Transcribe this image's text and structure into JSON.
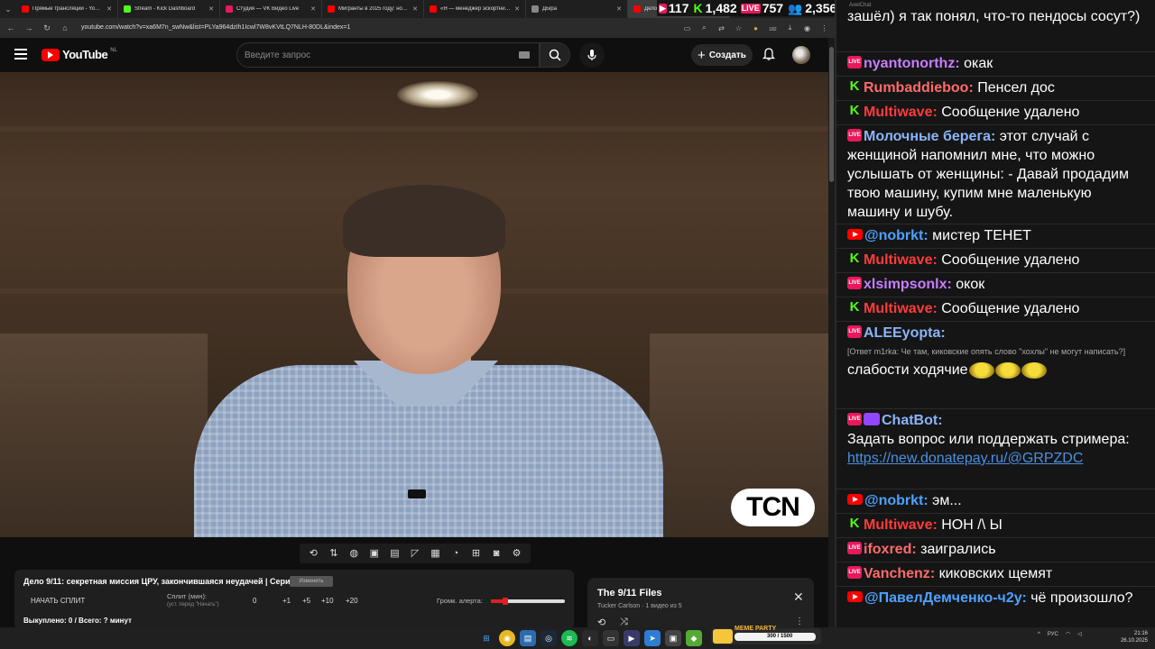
{
  "browser": {
    "tabs": [
      {
        "label": "Прямые трансляции - YouTube",
        "color": "#ff0000"
      },
      {
        "label": "Stream - Kick Dashboard",
        "color": "#53fc18"
      },
      {
        "label": "Студия — VK Видео Live",
        "color": "#e8195b"
      },
      {
        "label": "Мигранты в 2025 году: новая",
        "color": "#ff0000"
      },
      {
        "label": "«Я — менеджер эскортниц»",
        "color": "#ff0000"
      },
      {
        "label": "ДЫра",
        "color": "#888888"
      },
      {
        "label": "Дело 9/11",
        "color": "#ff0000"
      }
    ],
    "url": "youtube.com/watch?v=xa6M7n_swNw&list=PLYa964dzIh1Icwl7W8vKVtLQ7NLH-80DL&index=1",
    "badge_count": "182"
  },
  "stats": {
    "vk_viewers": "117",
    "kick_viewers": "1,482",
    "live_viewers": "757",
    "total_viewers": "2,356"
  },
  "youtube": {
    "logo_text": "YouTube",
    "region": "NL",
    "search_placeholder": "Введите запрос",
    "create_label": "Создать"
  },
  "video": {
    "watermark": "TCN"
  },
  "split_panel": {
    "title": "Дело 9/11: секретная миссия ЦРУ, закончившаяся неудачей | Серия 1",
    "change_label": "Изменить",
    "start_label": "НАЧАТЬ СПЛИТ",
    "split_label": "Сплит (мин):",
    "split_hint": "(уст. перед \"Начать\")",
    "split_value": "0",
    "increments": [
      "+1",
      "+5",
      "+10",
      "+20"
    ],
    "alert_label": "Громк. алерта:",
    "alert_volume": 0.2,
    "bought_text": "Выкуплено: 0 / Всего: ? минут"
  },
  "playlist": {
    "title": "The 9/11 Files",
    "subtitle": "Tucker Carlson · 1 видео из 5"
  },
  "chat": {
    "app_title": "AxelChat",
    "top_text": "зашёл) я так понял, что-то пендосы сосут?)",
    "messages": [
      {
        "platform": "vk",
        "user": "nyantonorthz",
        "color": "#c77dff",
        "text": "окак"
      },
      {
        "platform": "kick",
        "user": "Rumbaddieboo",
        "color": "#ff6b6b",
        "text": "Пенсел дос"
      },
      {
        "platform": "kick",
        "user": "Multiwave",
        "color": "#ff3b3b",
        "text": "Сообщение удалено"
      },
      {
        "platform": "vk",
        "user": "Молочные берега",
        "color": "#8ab4f8",
        "text": "этот случай с женщиной напомнил мне, что можно услышать от женщины: - Давай продадим твою машину, купим мне маленькую машину и шубу."
      },
      {
        "platform": "yt",
        "user": "@nobrkt",
        "color": "#4ea1ff",
        "text": "мистер ТЕНЕТ"
      },
      {
        "platform": "kick",
        "user": "Multiwave",
        "color": "#ff3b3b",
        "text": "Сообщение удалено"
      },
      {
        "platform": "vk",
        "user": "xlsimpsonlx",
        "color": "#c77dff",
        "text": "окок"
      },
      {
        "platform": "kick",
        "user": "Multiwave",
        "color": "#ff3b3b",
        "text": "Сообщение удалено"
      },
      {
        "platform": "vk",
        "user": "ALEEyopta",
        "color": "#8ab4f8",
        "text": "",
        "reply": "[Ответ m1rka: Че там, киковские опять слово \"хохлы\" не могут написать?]",
        "text2": "слабости ходячие"
      },
      {
        "platform": "bot",
        "user": "ChatBot",
        "color": "#8ab4f8",
        "text": "Задать вопрос или поддержать стримера:",
        "link": "https://new.donatepay.ru/@GRPZDC"
      },
      {
        "platform": "yt",
        "user": "@nobrkt",
        "color": "#4ea1ff",
        "text": "эм..."
      },
      {
        "platform": "kick",
        "user": "Multiwave",
        "color": "#ff3b3b",
        "text": "НОН /\\ Ы"
      },
      {
        "platform": "vk",
        "user": "ifoxred",
        "color": "#ff6b6b",
        "text": "заигрались"
      },
      {
        "platform": "vk",
        "user": "Vanchenz",
        "color": "#ff6b6b",
        "text": "киковских щемят"
      },
      {
        "platform": "yt",
        "user": "@ПавелДемченко-ч2у",
        "color": "#4ea1ff",
        "text": "чё произошло?"
      }
    ]
  },
  "taskbar": {
    "meme_title": "MEME PARTY",
    "meme_count": "300 / 1500",
    "lang": "РУС",
    "time": "21:16",
    "date": "26.10.2025"
  }
}
